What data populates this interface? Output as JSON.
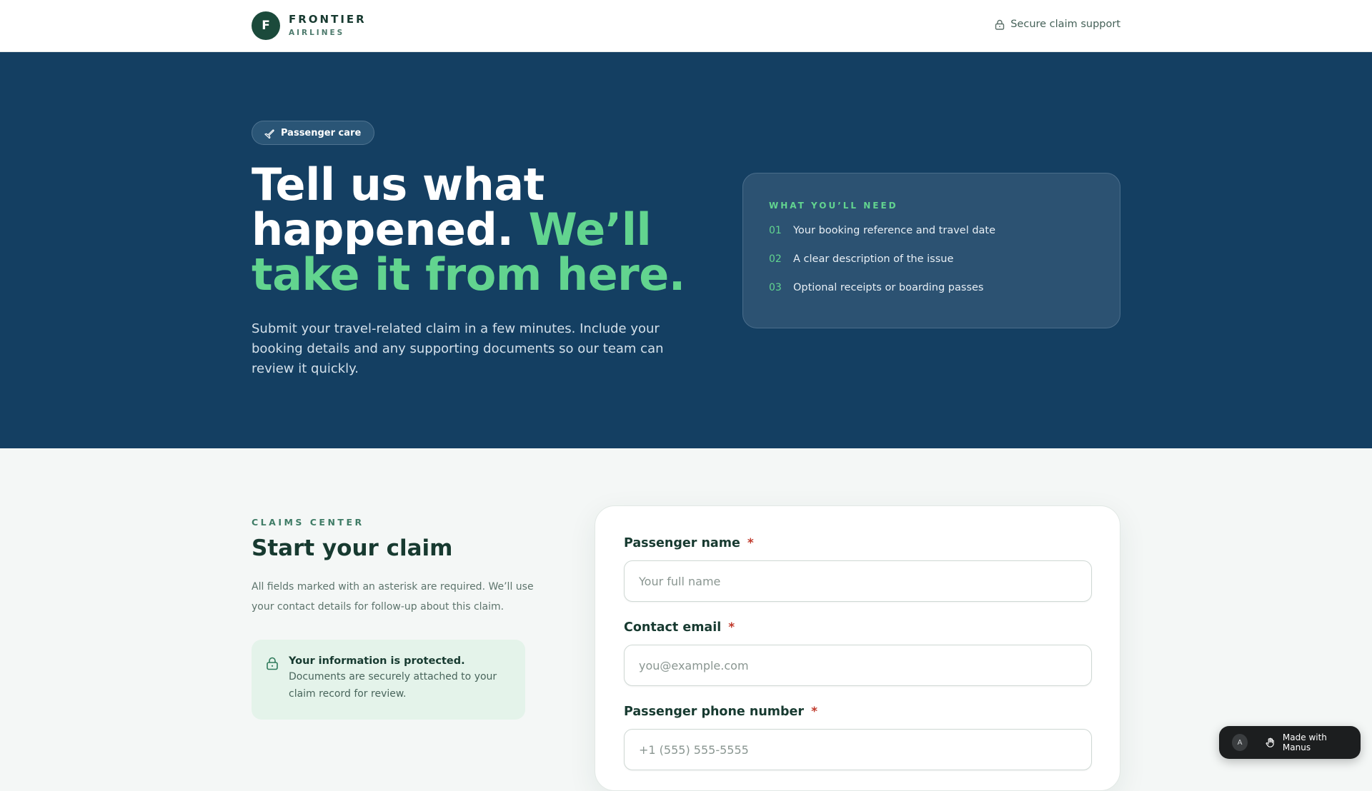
{
  "header": {
    "brand_letter": "F",
    "brand_name": "FRONTIER",
    "brand_sub": "AIRLINES",
    "secure_link": "Secure claim support"
  },
  "hero": {
    "pill_label": "Passenger care",
    "title_line1": "Tell us what happened.",
    "title_accent": "We’ll take it from here.",
    "description": "Submit your travel-related claim in a few minutes. Include your booking details and any supporting documents so our team can review it quickly.",
    "needs": {
      "heading": "WHAT YOU’LL NEED",
      "items": [
        {
          "num": "01",
          "text": "Your booking reference and travel date"
        },
        {
          "num": "02",
          "text": "A clear description of the issue"
        },
        {
          "num": "03",
          "text": "Optional receipts or boarding passes"
        }
      ]
    }
  },
  "claims": {
    "eyebrow": "CLAIMS CENTER",
    "title": "Start your claim",
    "description": "All fields marked with an asterisk are required. We’ll use your contact details for follow-up about this claim.",
    "protect_title": "Your information is protected.",
    "protect_body": "Documents are securely attached to your claim record for review."
  },
  "form": {
    "required_mark": "*",
    "fields": [
      {
        "label": "Passenger name",
        "placeholder": "Your full name",
        "value": ""
      },
      {
        "label": "Contact email",
        "placeholder": "you@example.com",
        "value": ""
      },
      {
        "label": "Passenger phone number",
        "placeholder": "+1 (555) 555-5555",
        "value": ""
      }
    ]
  },
  "badge": {
    "avatar_letter": "A",
    "label": "Made with Manus"
  },
  "colors": {
    "hero_bg": "#143f62",
    "accent_green": "#62d48f",
    "brand_dark": "#1b4a3b",
    "required_red": "#c0392b"
  }
}
